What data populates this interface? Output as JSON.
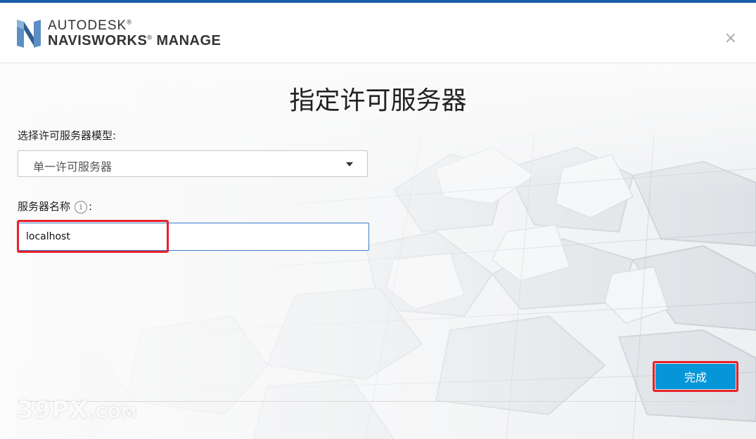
{
  "header": {
    "brand_line1": "AUTODESK",
    "brand_line1_mark": "®",
    "brand_line2": "NAVISWORKS",
    "brand_line2_mark": "®",
    "brand_line2_suffix": " MANAGE",
    "logo_icon": "navisworks-n-logo",
    "close_label": "×"
  },
  "main": {
    "title": "指定许可服务器",
    "model_label": "选择许可服务器模型:",
    "model_selected": "单一许可服务器",
    "server_name_label": "服务器名称",
    "server_name_suffix": ":",
    "info_glyph": "i",
    "server_name_value": "localhost",
    "done_label": "完成"
  },
  "watermark": {
    "main": "39PX",
    "suffix": ".COM"
  },
  "colors": {
    "accent": "#1a5ea8",
    "button": "#0696d7",
    "highlight": "#e8212a",
    "input_border": "#3d7cc9"
  }
}
